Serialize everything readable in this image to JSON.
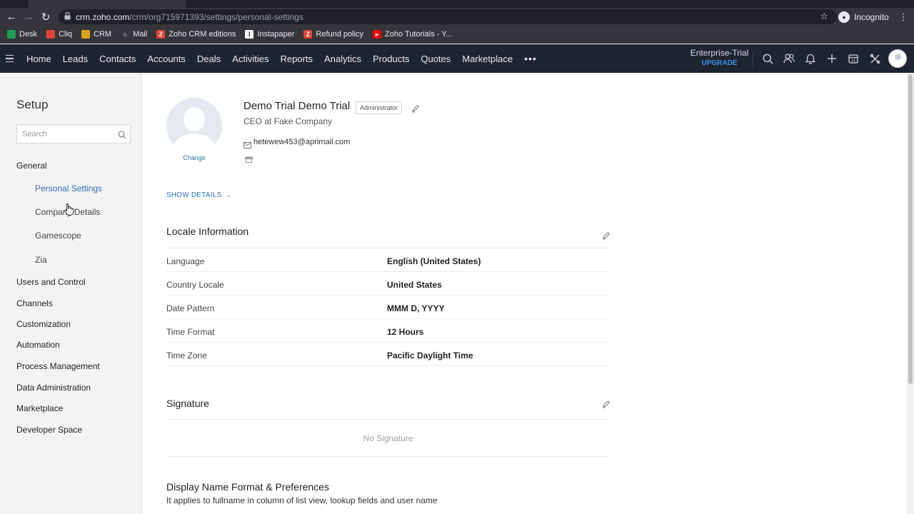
{
  "browser": {
    "url_host": "crm.zoho.com",
    "url_path": "/crm/org715971393/settings/personal-settings",
    "incognito_label": "Incognito",
    "bookmarks": [
      {
        "label": "Desk",
        "color": "#1e9e5a",
        "icon": "desk-icon"
      },
      {
        "label": "Cliq",
        "color": "#e0433a",
        "icon": "cliq-icon"
      },
      {
        "label": "CRM",
        "color": "#d9a21b",
        "icon": "crm-icon"
      },
      {
        "label": "Mail",
        "color": "#7a8b9c",
        "icon": "mail-icon"
      },
      {
        "label": "Zoho CRM editions",
        "color": "#e0433a",
        "icon": "zoho-icon"
      },
      {
        "label": "Instapaper",
        "color": "#ffffff",
        "icon": "instapaper-icon"
      },
      {
        "label": "Refund policy",
        "color": "#e0433a",
        "icon": "zoho-icon"
      },
      {
        "label": "Zoho Tutorials - Y...",
        "color": "#ff0000",
        "icon": "youtube-icon"
      }
    ]
  },
  "topnav": {
    "tabs": [
      "Home",
      "Leads",
      "Contacts",
      "Accounts",
      "Deals",
      "Activities",
      "Reports",
      "Analytics",
      "Products",
      "Quotes",
      "Marketplace"
    ],
    "more": "•••",
    "edition": "Enterprise-Trial",
    "upgrade": "UPGRADE"
  },
  "sidebar": {
    "title": "Setup",
    "search_placeholder": "Search",
    "general": "General",
    "general_items": [
      "Personal Settings",
      "Company Details",
      "Gamescope",
      "Zia"
    ],
    "groups": [
      "Users and Control",
      "Channels",
      "Customization",
      "Automation",
      "Process Management",
      "Data Administration",
      "Marketplace",
      "Developer Space"
    ]
  },
  "profile": {
    "name": "Demo Trial Demo Trial",
    "role": "Administrator",
    "title": "CEO at Fake Company",
    "email": "hetewew453@aprimail.com",
    "change_label": "Change",
    "show_details": "SHOW DETAILS"
  },
  "locale": {
    "title": "Locale Information",
    "rows": [
      {
        "label": "Language",
        "value": "English (United States)"
      },
      {
        "label": "Country Locale",
        "value": "United States"
      },
      {
        "label": "Date Pattern",
        "value": "MMM D, YYYY"
      },
      {
        "label": "Time Format",
        "value": "12 Hours"
      },
      {
        "label": "Time Zone",
        "value": "Pacific Daylight Time"
      }
    ]
  },
  "signature": {
    "title": "Signature",
    "empty": "No Signature"
  },
  "display_name": {
    "title": "Display Name Format & Preferences",
    "subtitle": "It applies to fullname in column of list view, lookup fields and user name"
  },
  "colors": {
    "nav_bg": "#1e2430",
    "accent": "#2f6fb5",
    "upgrade": "#3d8ef0",
    "sidebar_bg": "#f3f3f4"
  }
}
